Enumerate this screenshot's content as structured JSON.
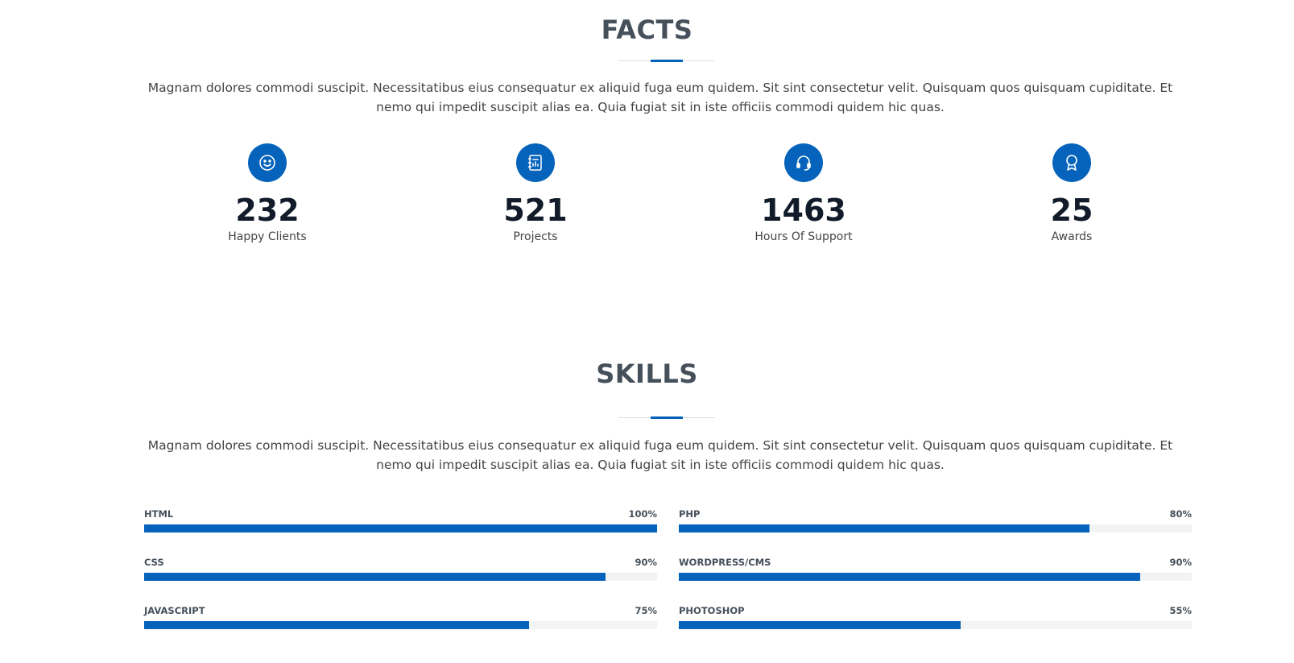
{
  "facts": {
    "title": "FACTS",
    "description": "Magnam dolores commodi suscipit. Necessitatibus eius consequatur ex aliquid fuga eum quidem. Sit sint consectetur velit. Quisquam quos quisquam cupiditate. Et nemo qui impedit suscipit alias ea. Quia fugiat sit in iste officiis commodi quidem hic quas.",
    "items": [
      {
        "icon": "smiley-icon",
        "number": "232",
        "label": "Happy Clients"
      },
      {
        "icon": "journal-chart-icon",
        "number": "521",
        "label": "Projects"
      },
      {
        "icon": "headset-icon",
        "number": "1463",
        "label": "Hours Of Support"
      },
      {
        "icon": "award-icon",
        "number": "25",
        "label": "Awards"
      }
    ]
  },
  "skills": {
    "title": "SKILLS",
    "description": "Magnam dolores commodi suscipit. Necessitatibus eius consequatur ex aliquid fuga eum quidem. Sit sint consectetur velit. Quisquam quos quisquam cupiditate. Et nemo qui impedit suscipit alias ea. Quia fugiat sit in iste officiis commodi quidem hic quas.",
    "items": [
      {
        "name": "HTML",
        "value_text": "100%",
        "percent": 100
      },
      {
        "name": "PHP",
        "value_text": "80%",
        "percent": 80
      },
      {
        "name": "CSS",
        "value_text": "90%",
        "percent": 90
      },
      {
        "name": "WORDPRESS/CMS",
        "value_text": "90%",
        "percent": 90
      },
      {
        "name": "JAVASCRIPT",
        "value_text": "75%",
        "percent": 75
      },
      {
        "name": "PHOTOSHOP",
        "value_text": "55%",
        "percent": 55
      }
    ]
  },
  "colors": {
    "accent": "#0563bb",
    "heading": "#45505b",
    "text": "#444444",
    "track": "#f2f3f5"
  }
}
